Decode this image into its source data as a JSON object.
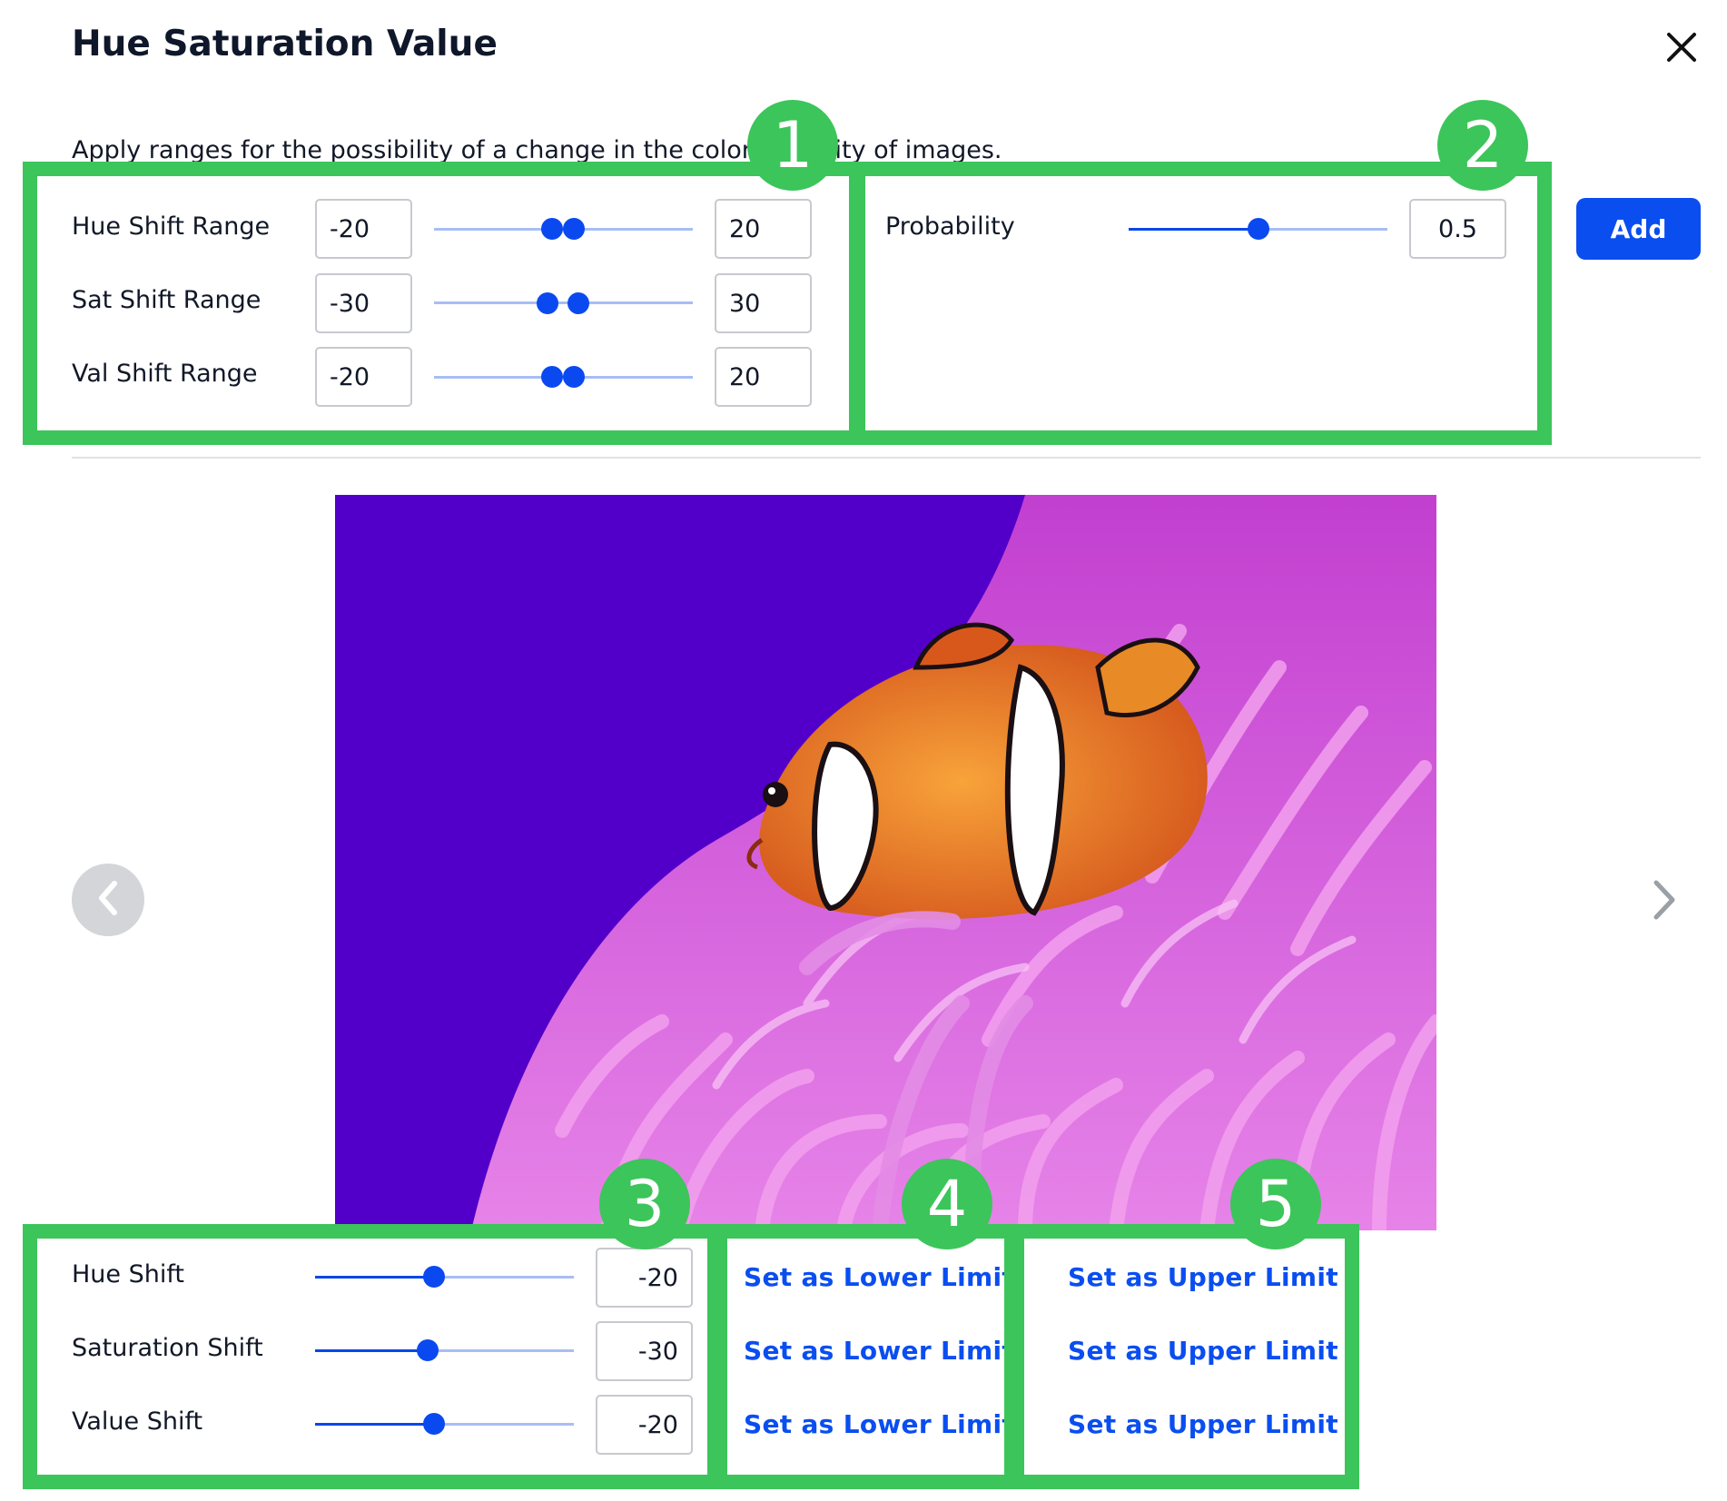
{
  "dialog": {
    "title": "Hue Saturation Value",
    "description": "Apply ranges for the possibility of a change in the color intensity of images.",
    "close_icon": "close-icon"
  },
  "ranges": [
    {
      "label": "Hue Shift Range",
      "min": "-20",
      "max": "20"
    },
    {
      "label": "Sat Shift Range",
      "min": "-30",
      "max": "30"
    },
    {
      "label": "Val Shift Range",
      "min": "-20",
      "max": "20"
    }
  ],
  "probability": {
    "label": "Probability",
    "value": "0.5"
  },
  "add_button": "Add",
  "preview": {
    "prev_icon": "chevron-left-icon",
    "next_icon": "chevron-right-icon"
  },
  "shifts": [
    {
      "label": "Hue Shift",
      "value": "-20"
    },
    {
      "label": "Saturation Shift",
      "value": "-30"
    },
    {
      "label": "Value Shift",
      "value": "-20"
    }
  ],
  "lower_limit_label": "Set as Lower Limit",
  "upper_limit_label": "Set as Upper Limit",
  "annotations": [
    "1",
    "2",
    "3",
    "4",
    "5"
  ],
  "colors": {
    "accent": "#0a4ef0",
    "annotation": "#3cc55a"
  }
}
